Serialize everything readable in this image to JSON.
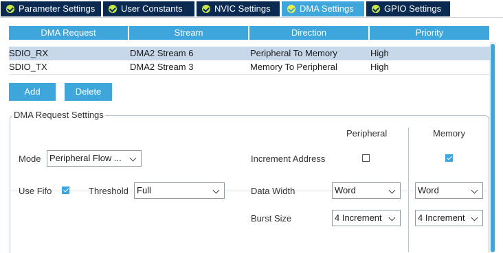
{
  "tabs": [
    {
      "label": "Parameter Settings",
      "active": false
    },
    {
      "label": "User Constants",
      "active": false
    },
    {
      "label": "NVIC Settings",
      "active": false
    },
    {
      "label": "DMA Settings",
      "active": true
    },
    {
      "label": "GPIO Settings",
      "active": false
    }
  ],
  "table": {
    "headers": [
      "DMA Request",
      "Stream",
      "Direction",
      "Priority"
    ],
    "rows": [
      {
        "request": "SDIO_RX",
        "stream": "DMA2 Stream 6",
        "direction": "Peripheral To Memory",
        "priority": "High",
        "selected": true
      },
      {
        "request": "SDIO_TX",
        "stream": "DMA2 Stream 3",
        "direction": "Memory To Peripheral",
        "priority": "High",
        "selected": false
      }
    ]
  },
  "buttons": {
    "add": "Add",
    "delete": "Delete"
  },
  "settings": {
    "legend": "DMA Request Settings",
    "peripheral_header": "Peripheral",
    "memory_header": "Memory",
    "mode_label": "Mode",
    "mode_value": "Peripheral Flow ...",
    "increment_label": "Increment Address",
    "increment_peripheral": false,
    "increment_memory": true,
    "fifo_label": "Use Fifo",
    "fifo_checked": true,
    "threshold_label": "Threshold",
    "threshold_value": "Full",
    "data_width_label": "Data Width",
    "data_width_peripheral": "Word",
    "data_width_memory": "Word",
    "burst_size_label": "Burst Size",
    "burst_size_peripheral": "4 Increment",
    "burst_size_memory": "4 Increment"
  },
  "colors": {
    "accent": "#3ea6db",
    "tab_dark": "#0a2a52",
    "selected_row": "#c7d8ea"
  }
}
